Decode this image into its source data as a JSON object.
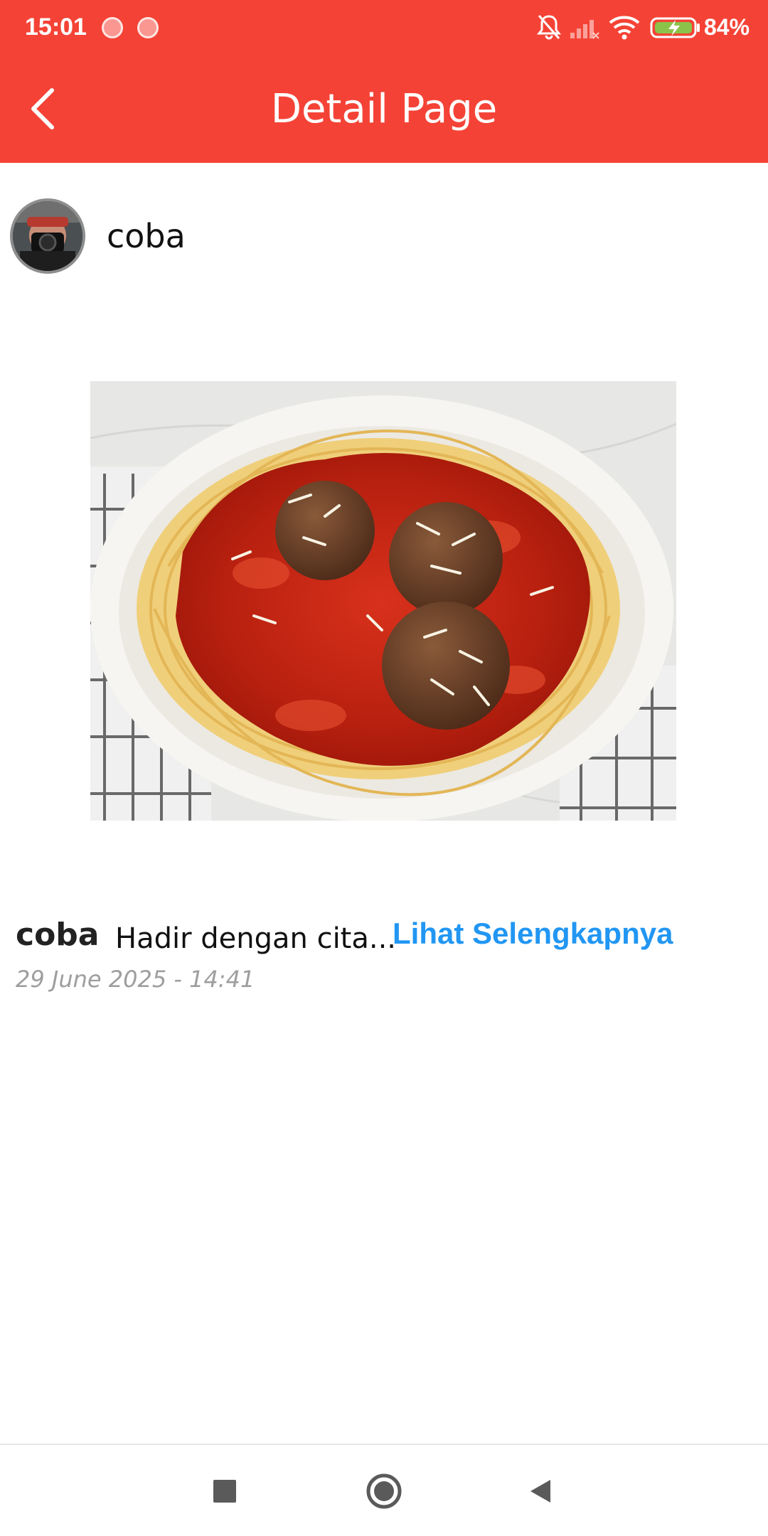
{
  "status_bar": {
    "time": "15:01",
    "battery_percent": "84%",
    "icons": [
      "notification-dot",
      "notification-dot",
      "bell-off-icon",
      "signal-icon",
      "wifi-icon",
      "battery-charging-icon"
    ]
  },
  "app_bar": {
    "title": "Detail Page",
    "back_icon": "chevron-left-icon",
    "background": "#f44336"
  },
  "post": {
    "author": "coba",
    "image_alt": "food photo",
    "caption_user": "coba",
    "caption_text": "Hadir dengan cita...",
    "see_more_label": "Lihat Selengkapnya",
    "date": "29 June 2025 - 14:41",
    "link_color": "#2196f3"
  },
  "nav_bar": {
    "buttons": [
      "recent-apps-icon",
      "home-icon",
      "back-icon"
    ]
  }
}
